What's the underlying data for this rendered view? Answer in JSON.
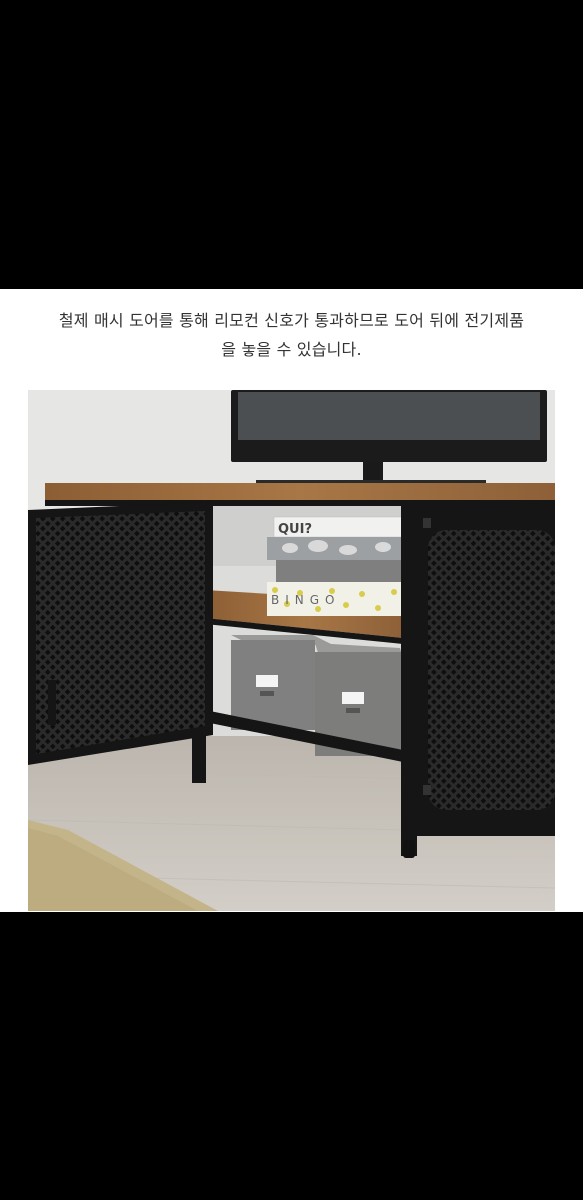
{
  "caption": {
    "line1": "철제 매시 도어를 통해 리모컨 신호가 통과하므로 도어 뒤에 전기제품",
    "line2": "을 놓을 수 있습니다."
  },
  "photo": {
    "box_top_label": "QUI?",
    "box_bingo_label": "BINGO",
    "colors": {
      "frame": "#151515",
      "wood": "#9a6a3e",
      "floor": "#c9c3bb",
      "wall": "#e4e4e2",
      "storage_box": "#7d7d7b"
    }
  }
}
